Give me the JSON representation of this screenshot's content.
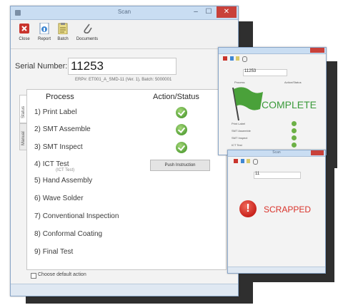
{
  "main": {
    "title": "Scan",
    "controls": {
      "minimize": "–",
      "maximize": "☐",
      "close": "✕"
    },
    "toolbar": [
      {
        "label": "Close",
        "icon": "close-icon"
      },
      {
        "label": "Report",
        "icon": "report-icon"
      },
      {
        "label": "Batch",
        "icon": "batch-icon"
      },
      {
        "label": "Documents",
        "icon": "paperclip-icon"
      }
    ],
    "serial_label": "Serial Number:",
    "serial_value": "11253",
    "serial_sub": "ERP#: ET001_A_SMD-11 (Ver. 1), Batch: 5000001",
    "tabs": [
      "Status",
      "Manual"
    ],
    "table": {
      "process_header": "Process",
      "action_header": "Action/Status",
      "rows": [
        {
          "n": "1)",
          "name": "Print Label",
          "status": "done"
        },
        {
          "n": "2)",
          "name": "SMT Assemble",
          "status": "done"
        },
        {
          "n": "3)",
          "name": "SMT Inspect",
          "status": "done"
        },
        {
          "n": "4)",
          "name": "ICT Test",
          "note": "(ICT Test)",
          "action": "Push Instruction"
        },
        {
          "n": "5)",
          "name": "Hand Assembly"
        },
        {
          "n": "6)",
          "name": "Wave Solder"
        },
        {
          "n": "7)",
          "name": "Conventional Inspection"
        },
        {
          "n": "8)",
          "name": "Conformal Coating"
        },
        {
          "n": "9)",
          "name": "Final Test"
        }
      ]
    },
    "default_action_label": "Choose default action"
  },
  "complete_window": {
    "serial_value": "11253",
    "status_text": "COMPLETE",
    "process_header": "Process",
    "action_header": "Action/Status",
    "rows": [
      "Print Label",
      "SMT Assemble",
      "SMT Inspect",
      "ICT Test"
    ]
  },
  "scrapped_window": {
    "title": "Scan",
    "serial_value": "11",
    "status_text": "SCRAPPED"
  },
  "colors": {
    "accent": "#2f7fc6",
    "complete_green": "#3a9a3a",
    "scrapped_red": "#d9332b",
    "check_green": "#6cb046"
  }
}
